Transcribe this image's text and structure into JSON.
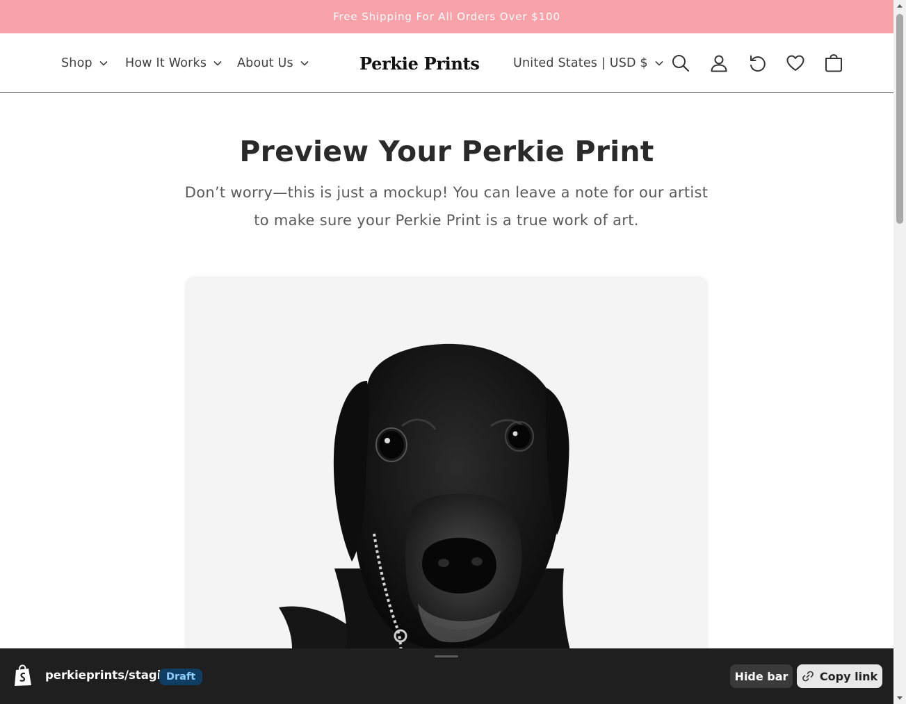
{
  "announcement": {
    "text": "Free Shipping For All Orders Over $100"
  },
  "colors": {
    "announcement_bg": "#f8a3aa",
    "bottom_bar_bg": "#1f1f1f",
    "draft_badge_bg": "#103e63",
    "draft_badge_text": "#8fd0ff"
  },
  "nav": {
    "items": [
      {
        "label": "Shop"
      },
      {
        "label": "How It Works"
      },
      {
        "label": "About Us"
      }
    ]
  },
  "logo": {
    "text": "Perkie Prints"
  },
  "header": {
    "locale_label": "United States | USD $",
    "icons": [
      "search-icon",
      "account-icon",
      "reorder-icon",
      "wishlist-heart-icon",
      "cart-icon"
    ]
  },
  "main": {
    "title": "Preview Your Perkie Print",
    "subtitle_line1": "Don’t worry—this is just a mockup! You can leave a note for our artist",
    "subtitle_line2": "to make sure your Perkie Print is a true work of art."
  },
  "preview_bar": {
    "store": "perkieprints/staging",
    "badge": "Draft",
    "hide_label": "Hide bar",
    "copy_label": "Copy link"
  }
}
